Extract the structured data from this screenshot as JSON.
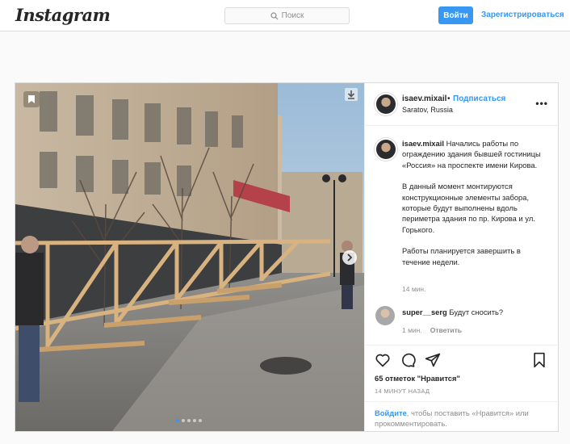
{
  "header": {
    "logo": "Instagram",
    "search_placeholder": "Поиск",
    "login_label": "Войти",
    "signup_label": "Зарегистрироваться"
  },
  "post": {
    "username": "isaev.mixail",
    "separator": "•",
    "follow_label": "Подписаться",
    "location": "Saratov, Russia",
    "more_label": "•••",
    "caption": {
      "paragraph1": "Начались работы по ограждению здания бывшей гостиницы «Россия» на проспекте имени Кирова.",
      "paragraph2": "В данный момент монтируются конструкционные элементы забора, которые будут выполнены вдоль периметра здания по пр. Кирова и ул. Горького.",
      "paragraph3": "Работы планируется завершить в течение недели.",
      "time": "14 мин."
    },
    "comments": [
      {
        "username": "super__serg",
        "text": "Будут сносить?",
        "time": "1 мин.",
        "reply_label": "Ответить"
      }
    ],
    "likes": "65 отметок \"Нравится\"",
    "posted_time": "14 МИНУТ НАЗАД",
    "login_prompt": {
      "link": "Войдите",
      "text": ", чтобы поставить «Нравится» или прокомментировать."
    },
    "carousel": {
      "total": 5,
      "active_index": 0
    }
  },
  "colors": {
    "accent": "#3897f0",
    "border": "#dbdbdb",
    "background": "#fafafa",
    "text": "#262626",
    "muted": "#8e8e8e"
  },
  "icons": [
    "search-icon",
    "bookmark-icon",
    "download-icon",
    "chevron-right-icon",
    "heart-icon",
    "comment-icon",
    "share-icon",
    "save-icon"
  ]
}
